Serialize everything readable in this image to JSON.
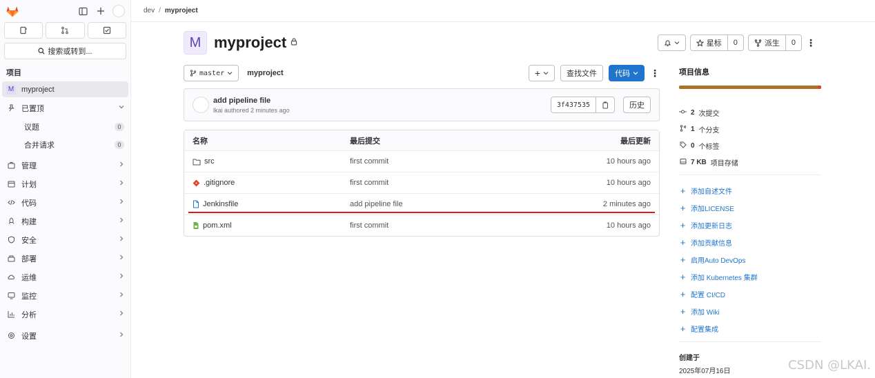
{
  "sidebar": {
    "search_label": "搜索或转到...",
    "section_title": "项目",
    "project": {
      "avatar": "M",
      "name": "myproject"
    },
    "items": [
      {
        "label": "已置顶",
        "icon": "pin-icon"
      },
      {
        "label": "议题",
        "count": "0"
      },
      {
        "label": "合并请求",
        "count": "0"
      },
      {
        "label": "管理",
        "icon": "briefcase-icon"
      },
      {
        "label": "计划",
        "icon": "calendar-icon"
      },
      {
        "label": "代码",
        "icon": "code-icon"
      },
      {
        "label": "构建",
        "icon": "rocket-icon"
      },
      {
        "label": "安全",
        "icon": "shield-icon"
      },
      {
        "label": "部署",
        "icon": "deployments-icon"
      },
      {
        "label": "运维",
        "icon": "cloud-gear-icon"
      },
      {
        "label": "监控",
        "icon": "monitor-icon"
      },
      {
        "label": "分析",
        "icon": "chart-icon"
      },
      {
        "label": "设置",
        "icon": "settings-icon"
      }
    ]
  },
  "breadcrumb": {
    "parent": "dev",
    "separator": "/",
    "current": "myproject"
  },
  "project": {
    "avatar": "M",
    "name": "myproject",
    "star_label": "星标",
    "star_count": "0",
    "fork_label": "派生",
    "fork_count": "0"
  },
  "toolbar": {
    "branch": "master",
    "path": "myproject",
    "add": "+",
    "find_file": "查找文件",
    "code": "代码"
  },
  "commit": {
    "title": "add pipeline file",
    "meta": "lkai authored 2 minutes ago",
    "sha": "3f437535",
    "history": "历史"
  },
  "files": {
    "headers": {
      "name": "名称",
      "last_commit": "最后提交",
      "last_update": "最后更新"
    },
    "rows": [
      {
        "name": "src",
        "icon": "folder-icon",
        "commit": "first commit",
        "updated": "10 hours ago"
      },
      {
        "name": ".gitignore",
        "icon": "git-icon",
        "commit": "first commit",
        "updated": "10 hours ago"
      },
      {
        "name": "Jenkinsfile",
        "icon": "file-icon",
        "commit": "add pipeline file",
        "updated": "2 minutes ago"
      },
      {
        "name": "pom.xml",
        "icon": "xml-file-icon",
        "commit": "first commit",
        "updated": "10 hours ago"
      }
    ]
  },
  "info": {
    "title": "项目信息",
    "stats": [
      {
        "icon": "commit-icon",
        "value": "2",
        "label": "次提交"
      },
      {
        "icon": "branch-icon",
        "value": "1",
        "label": "个分支"
      },
      {
        "icon": "tag-icon",
        "value": "0",
        "label": "个标签"
      },
      {
        "icon": "storage-icon",
        "value": "7 KB",
        "label": "项目存储"
      }
    ],
    "links": [
      "添加自述文件",
      "添加LICENSE",
      "添加更新日志",
      "添加贡献信息",
      "启用Auto DevOps",
      "添加 Kubernetes 集群",
      "配置 CI/CD",
      "添加 Wiki",
      "配置集成"
    ],
    "created_title": "创建于",
    "created_date": "2025年07月16日"
  },
  "watermark": "CSDN @LKAI.",
  "colors": {
    "accent": "#1f75cb",
    "language": "#a8722a",
    "highlight": "#e0161a"
  }
}
